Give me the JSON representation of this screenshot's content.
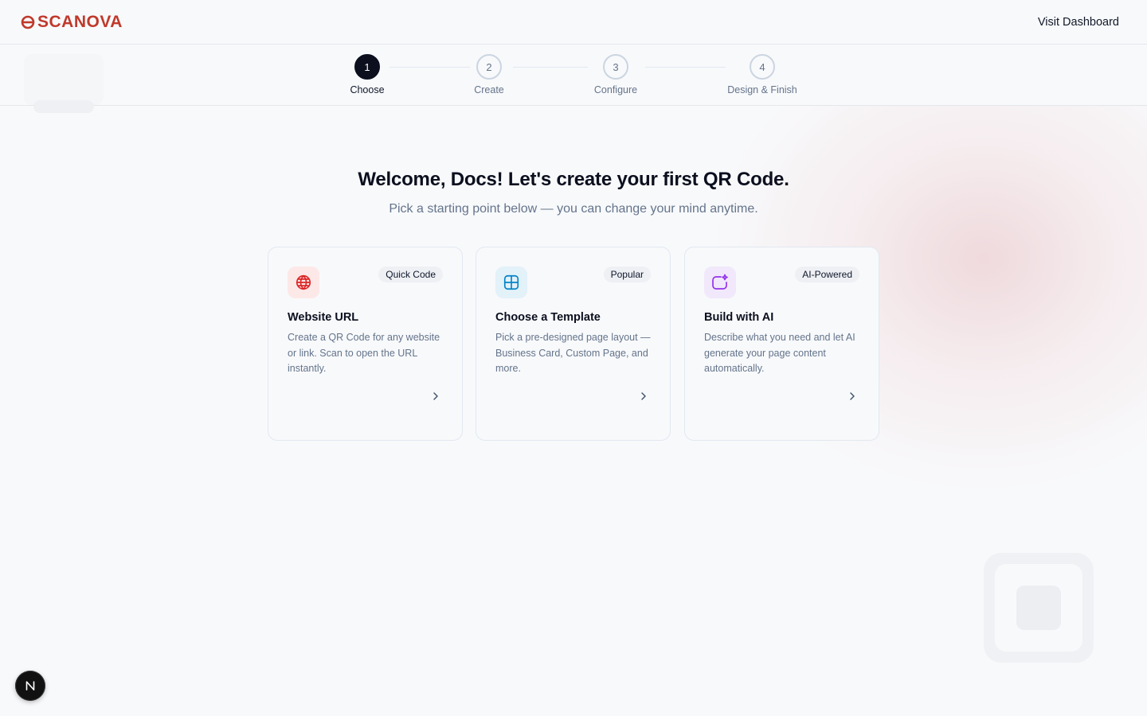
{
  "brand": {
    "name": "SCANOVA",
    "color": "#c0392b",
    "icon": "logo-mark-icon"
  },
  "header": {
    "visit_dashboard": "Visit Dashboard"
  },
  "stepper": {
    "steps": [
      {
        "number": "1",
        "label": "Choose",
        "active": true
      },
      {
        "number": "2",
        "label": "Create",
        "active": false
      },
      {
        "number": "3",
        "label": "Configure",
        "active": false
      },
      {
        "number": "4",
        "label": "Design & Finish",
        "active": false
      }
    ]
  },
  "hero": {
    "title": "Welcome, Docs! Let's create your first QR Code.",
    "subtitle": "Pick a starting point below — you can change your mind anytime."
  },
  "cards": [
    {
      "badge": "Quick Code",
      "title": "Website URL",
      "description": "Create a QR Code for any website or link. Scan to open the URL instantly.",
      "icon": "globe-icon",
      "icon_color": "#dc2626"
    },
    {
      "badge": "Popular",
      "title": "Choose a Template",
      "description": "Pick a pre-designed page layout — Business Card, Custom Page, and more.",
      "icon": "layout-grid-icon",
      "icon_color": "#0284c7"
    },
    {
      "badge": "AI-Powered",
      "title": "Build with AI",
      "description": "Describe what you need and let AI generate your page content automatically.",
      "icon": "sparkle-icon",
      "icon_color": "#9333ea"
    }
  ],
  "dev_badge": {
    "letter": "N"
  }
}
